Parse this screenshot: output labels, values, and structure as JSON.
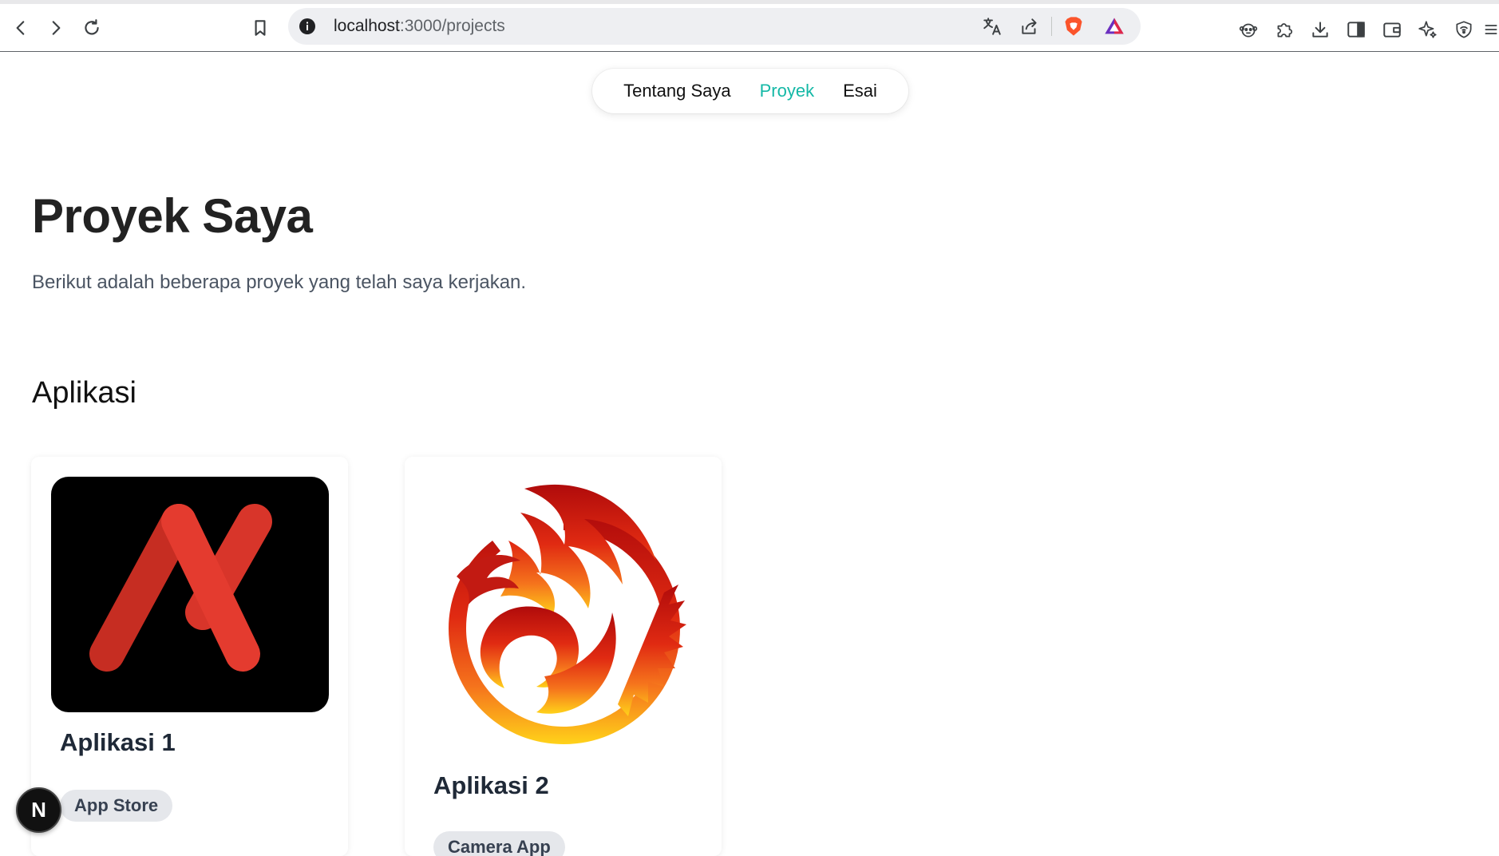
{
  "browser": {
    "url_host": "localhost",
    "url_path": ":3000/projects",
    "colors": {
      "toolbar_bg": "#ffffff",
      "omnibox_bg": "#eeeff2",
      "brave_orange": "#fb542b"
    },
    "icons": {
      "back": "back-arrow-icon",
      "forward": "forward-arrow-icon",
      "reload": "reload-icon",
      "bookmark": "bookmark-icon",
      "site_info": "info-icon",
      "translate": "translate-icon",
      "share": "share-icon",
      "brave_shields": "brave-lion-icon",
      "brave_rewards": "rewards-triangle-icon",
      "extensions": [
        "monkey-extension-icon",
        "puzzle-icon",
        "download-icon",
        "sidebar-icon",
        "wallet-icon",
        "leo-ai-icon",
        "vpn-shield-icon",
        "menu-icon"
      ]
    }
  },
  "nav": {
    "items": [
      {
        "label": "Tentang Saya",
        "active": false
      },
      {
        "label": "Proyek",
        "active": true
      },
      {
        "label": "Esai",
        "active": false
      }
    ],
    "active_color": "#14b8a6"
  },
  "page": {
    "title": "Proyek Saya",
    "subtitle": "Berikut adalah beberapa proyek yang telah saya kerjakan.",
    "section_title": "Aplikasi"
  },
  "projects": [
    {
      "title": "Aplikasi 1",
      "tag": "App Store",
      "image": "red-lambda-logo"
    },
    {
      "title": "Aplikasi 2",
      "tag": "Camera App",
      "image": "phoenix-fire-logo"
    }
  ],
  "dev_badge": {
    "label": "N",
    "icon": "nextjs-icon"
  }
}
